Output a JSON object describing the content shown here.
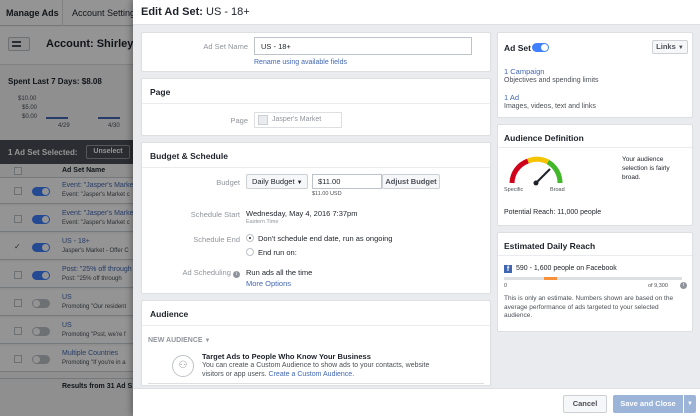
{
  "topnav": {
    "manage_ads": "Manage Ads",
    "account_settings": "Account Settings"
  },
  "account": {
    "label": "Account: Shirley L"
  },
  "spent": {
    "label": "Spent Last 7 Days: $8.08",
    "y_ticks": [
      "$10.00",
      "$5.00",
      "$0.00"
    ],
    "dates": [
      "4/29",
      "4/30"
    ]
  },
  "selection": {
    "text": "1 Ad Set Selected:",
    "unselect": "Unselect"
  },
  "table": {
    "header": "Ad Set Name",
    "rows": [
      {
        "name": "Event: \"Jasper's Market",
        "sub": "Event: \"Jasper's Market c",
        "on": true,
        "checked": false
      },
      {
        "name": "Event: \"Jasper's Market",
        "sub": "Event: \"Jasper's Market c",
        "on": true,
        "checked": false
      },
      {
        "name": "US - 18+",
        "sub": "Jasper's Market - Offer C",
        "on": true,
        "checked": true
      },
      {
        "name": "Post: \"25% off through",
        "sub": "Post: \"25% off through",
        "on": true,
        "checked": false
      },
      {
        "name": "US",
        "sub": "Promoting \"Our resident",
        "on": false,
        "checked": false
      },
      {
        "name": "US",
        "sub": "Promoting \"Psst, we're f",
        "on": false,
        "checked": false
      },
      {
        "name": "Multiple Countries",
        "sub": "Promoting \"If you're in a",
        "on": false,
        "checked": false
      }
    ],
    "footer": "Results from 31 Ad S"
  },
  "dialog": {
    "title": "Edit Ad Set:",
    "title_name": "US - 18+",
    "adset_name_label": "Ad Set Name",
    "adset_name_value": "US - 18+",
    "rename_link": "Rename using available fields",
    "page_section": "Page",
    "page_label": "Page",
    "page_value": "Jasper's Market",
    "budget_section": "Budget & Schedule",
    "budget_label": "Budget",
    "budget_type": "Daily Budget",
    "budget_amount": "$11.00",
    "budget_usd": "$11.00 USD",
    "adjust_budget": "Adjust Budget",
    "schedule_start_label": "Schedule Start",
    "schedule_start_value": "Wednesday, May 4, 2016 7:37pm",
    "schedule_tz": "Eastern Time",
    "schedule_end_label": "Schedule End",
    "end_option1": "Don't schedule end date, run as ongoing",
    "end_option2": "End run on:",
    "ad_scheduling_label": "Ad Scheduling",
    "ad_scheduling_value": "Run ads all the time",
    "more_options": "More Options",
    "audience_section": "Audience",
    "new_audience": "NEW AUDIENCE",
    "custom_title": "Target Ads to People Who Know Your Business",
    "custom_text1": "You can create a Custom Audience to show ads to your contacts, website",
    "custom_text2": "visitors or app users.",
    "custom_link": "Create a Custom Audience.",
    "cancel": "Cancel",
    "save_close": "Save and Close"
  },
  "side": {
    "adset_label": "Ad Set",
    "links_btn": "Links",
    "campaign_count": "1 Campaign",
    "campaign_desc": "Objectives and spending limits",
    "ad_count": "1 Ad",
    "ad_desc": "Images, videos, text and links",
    "audience_def": "Audience Definition",
    "gauge_specific": "Specific",
    "gauge_broad": "Broad",
    "audience_note": "Your audience selection is fairly broad.",
    "potential_reach": "Potential Reach: 11,000 people",
    "est_reach": "Estimated Daily Reach",
    "reach_value": "590 - 1,600 people on Facebook",
    "reach_min": "0",
    "reach_max": "of 9,300",
    "reach_fraction": 0.093,
    "reach_note": "This is only an estimate. Numbers shown are based on the average performance of ads targeted to your selected audience.",
    "brand_blue": "#4267b2"
  }
}
